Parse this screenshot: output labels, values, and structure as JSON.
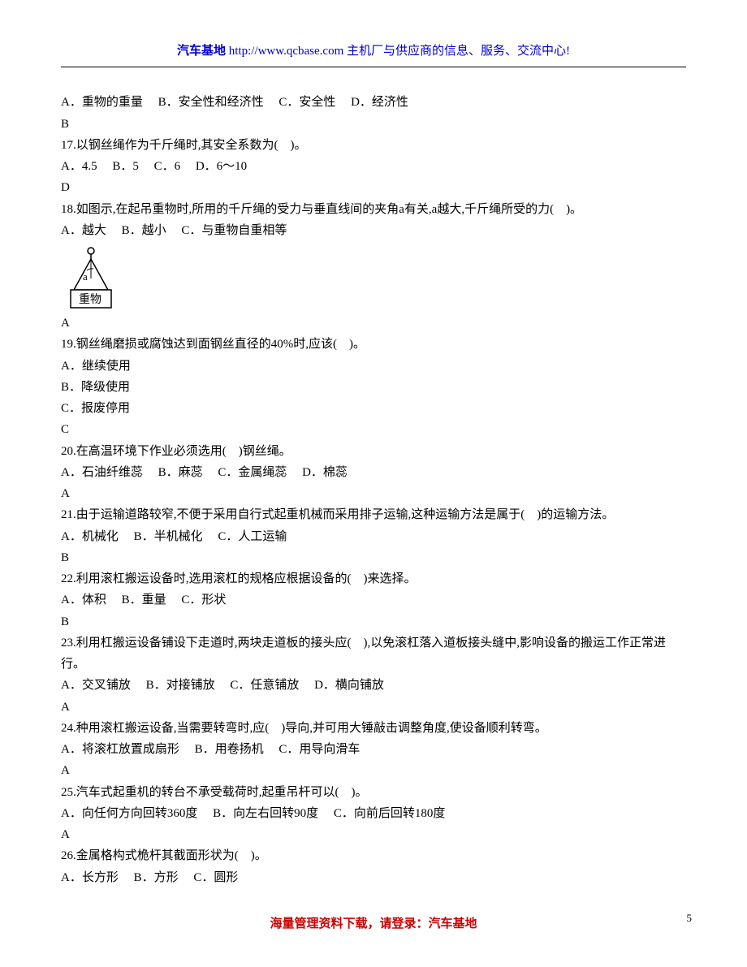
{
  "header": {
    "site": "汽车基地",
    "url": "http://www.qcbase.com",
    "desc": "主机厂与供应商的信息、服务、交流中心!"
  },
  "q16": {
    "opts": "A．重物的重量     B．安全性和经济性     C．安全性     D．经济性",
    "ans": "B"
  },
  "q17": {
    "text": "17.以钢丝绳作为千斤绳时,其安全系数为(    )。",
    "opts": "A．4.5     B．5     C．6     D．6～10",
    "ans": "D"
  },
  "q18": {
    "text": "18.如图示,在起吊重物时,所用的千斤绳的受力与垂直线间的夹角a有关,a越大,千斤绳所受的力(    )。",
    "opts": "A．越大     B．越小     C．与重物自重相等",
    "diagram_label": "重物",
    "diagram_alpha": "a",
    "ans": "A"
  },
  "q19": {
    "text": "19.钢丝绳磨损或腐蚀达到面钢丝直径的40%时,应该(    )。",
    "a": "A．继续使用",
    "b": "B．降级使用",
    "c": "C．报废停用",
    "ans": "C"
  },
  "q20": {
    "text": "20.在高温环境下作业必须选用(    )钢丝绳。",
    "opts": "A．石油纤维蕊     B．麻蕊     C．金属绳蕊     D．棉蕊",
    "ans": "A"
  },
  "q21": {
    "text": "21.由于运输道路较窄,不便于采用自行式起重机械而采用排子运输,这种运输方法是属于(    )的运输方法。",
    "opts": "A．机械化     B．半机械化     C．人工运输",
    "ans": "B"
  },
  "q22": {
    "text": "22.利用滚杠搬运设备时,选用滚杠的规格应根据设备的(    )来选择。",
    "opts": "A．体积     B．重量     C．形状",
    "ans": "B"
  },
  "q23": {
    "text": "23.利用杠搬运设备铺设下走道时,两块走道板的接头应(    ),以免滚杠落入道板接头缝中,影响设备的搬运工作正常进行。",
    "opts": "A．交叉铺放     B．对接铺放     C．任意铺放     D．横向铺放",
    "ans": "A"
  },
  "q24": {
    "text": "24.种用滚杠搬运设备,当需要转弯时,应(    )导向,并可用大锤敲击调整角度,使设备顺利转弯。",
    "opts": "A．将滚杠放置成扇形     B．用卷扬机     C．用导向滑车",
    "ans": "A"
  },
  "q25": {
    "text": "25.汽车式起重机的转台不承受载荷时,起重吊杆可以(    )。",
    "opts": "A．向任何方向回转360度     B．向左右回转90度     C．向前后回转180度",
    "ans": "A"
  },
  "q26": {
    "text": "26.金属格构式桅杆其截面形状为(    )。",
    "opts": "A．长方形     B．方形     C．圆形"
  },
  "footer": {
    "text": "海量管理资料下载，请登录：汽车基地"
  },
  "page_number": "5"
}
